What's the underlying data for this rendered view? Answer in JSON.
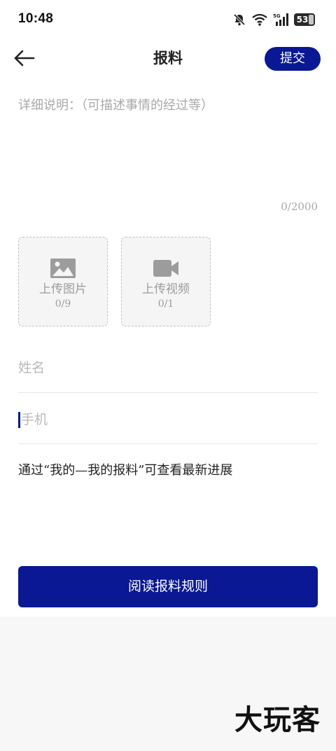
{
  "status_bar": {
    "time": "10:48",
    "battery_level": "53",
    "network_label": "5G",
    "icons": [
      "mute-icon",
      "wifi-icon",
      "signal-icon",
      "battery-icon"
    ]
  },
  "header": {
    "title": "报料",
    "submit_label": "提交",
    "back_icon": "arrow-left-icon"
  },
  "description": {
    "placeholder": "详细说明：（可描述事情的经过等）",
    "value": "",
    "counter": "0/2000"
  },
  "uploads": {
    "image": {
      "label": "上传图片",
      "count": "0/9",
      "icon": "image-icon"
    },
    "video": {
      "label": "上传视频",
      "count": "0/1",
      "icon": "video-camera-icon"
    }
  },
  "form": {
    "name_placeholder": "姓名",
    "phone_placeholder": "手机"
  },
  "hint": "通过“我的—我的报料”可查看最新进展",
  "rules_button_label": "阅读报料规则",
  "watermark": "大玩客",
  "colors": {
    "accent": "#0a1894",
    "placeholder": "#a9a9a9",
    "upload_bg": "#f5f5f5"
  }
}
